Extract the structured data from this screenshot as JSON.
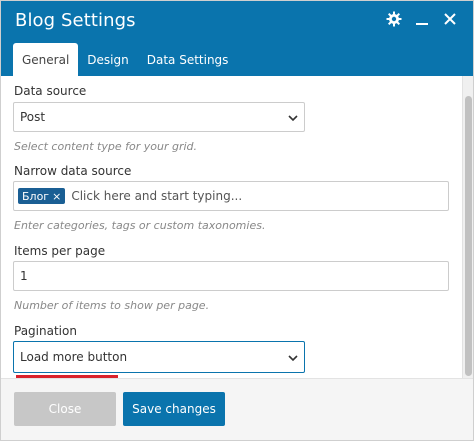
{
  "header": {
    "title": "Blog Settings",
    "icons": [
      "gear-icon",
      "minimize-icon",
      "close-icon"
    ],
    "bg_color": "#0a74ad"
  },
  "tabs": [
    {
      "label": "General",
      "active": true
    },
    {
      "label": "Design",
      "active": false
    },
    {
      "label": "Data Settings",
      "active": false
    }
  ],
  "fields": {
    "data_source": {
      "label": "Data source",
      "value": "Post",
      "hint": "Select content type for your grid."
    },
    "narrow": {
      "label": "Narrow data source",
      "tag": "Блог",
      "placeholder": "Click here and start typing...",
      "hint": "Enter categories, tags or custom taxonomies."
    },
    "items_per_page": {
      "label": "Items per page",
      "value": "1",
      "hint": "Number of items to show per page."
    },
    "pagination": {
      "label": "Pagination",
      "value": "Load more button"
    }
  },
  "footer": {
    "close_label": "Close",
    "save_label": "Save changes"
  }
}
